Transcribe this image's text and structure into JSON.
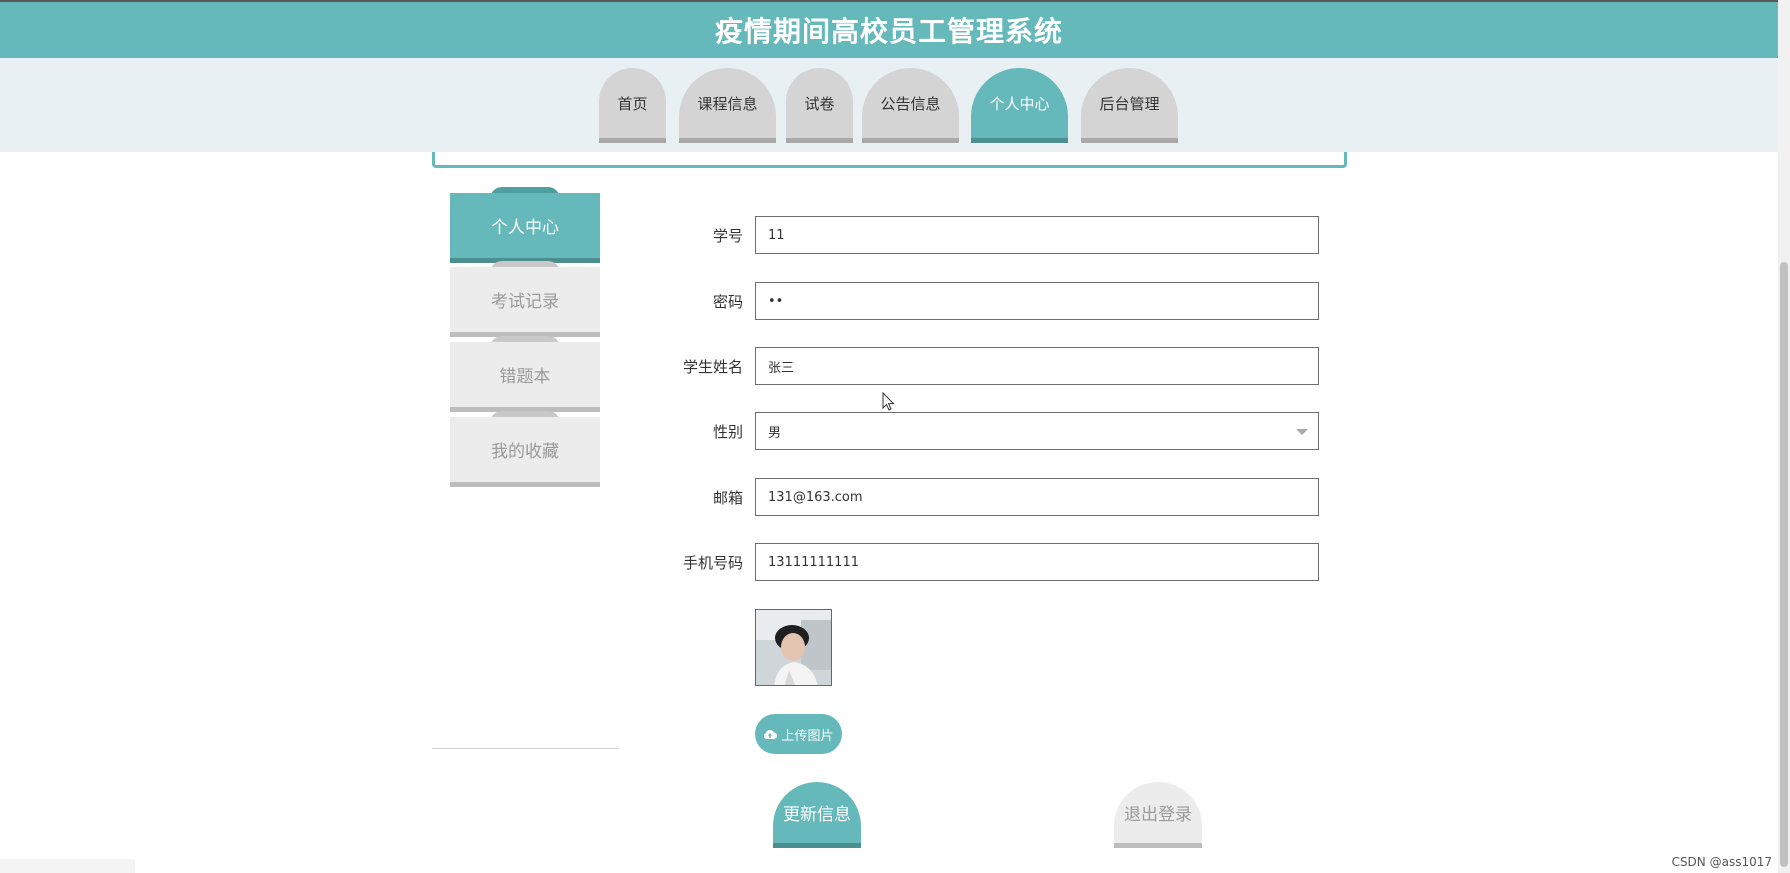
{
  "header": {
    "title": "疫情期间高校员工管理系统"
  },
  "nav": {
    "items": [
      {
        "label": "首页"
      },
      {
        "label": "课程信息"
      },
      {
        "label": "试卷"
      },
      {
        "label": "公告信息"
      },
      {
        "label": "个人中心",
        "active": true
      },
      {
        "label": "后台管理"
      }
    ]
  },
  "sidebar": {
    "items": [
      {
        "label": "个人中心",
        "active": true
      },
      {
        "label": "考试记录"
      },
      {
        "label": "错题本"
      },
      {
        "label": "我的收藏"
      }
    ]
  },
  "form": {
    "fields": [
      {
        "label": "学号",
        "value": "11"
      },
      {
        "label": "密码",
        "value": "••"
      },
      {
        "label": "学生姓名",
        "value": "张三"
      },
      {
        "label": "性别",
        "value": "男"
      },
      {
        "label": "邮箱",
        "value": "131@163.com"
      },
      {
        "label": "手机号码",
        "value": "13111111111"
      }
    ],
    "upload_label": "上传图片",
    "upload_icon": "cloud-upload-icon"
  },
  "actions": {
    "update": "更新信息",
    "logout": "退出登录"
  },
  "watermark": "CSDN @ass1017",
  "colors": {
    "primary": "#66b9bb",
    "inactive": "#d4d4d4"
  }
}
